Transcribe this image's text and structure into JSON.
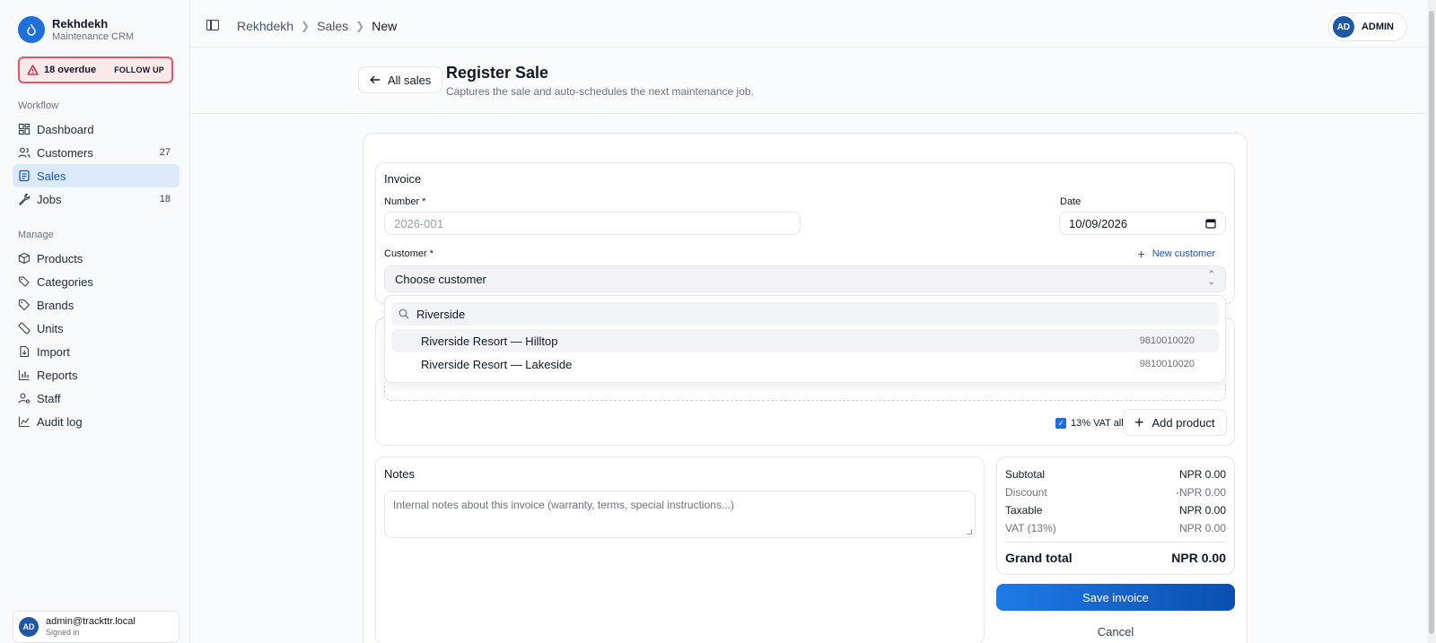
{
  "app": {
    "name": "Rekhdekh",
    "subtitle": "Maintenance CRM"
  },
  "alert": {
    "count_text": "18 overdue",
    "action": "FOLLOW UP"
  },
  "sidebar": {
    "workflow_label": "Workflow",
    "manage_label": "Manage",
    "workflow": [
      {
        "label": "Dashboard",
        "icon": "grid-icon"
      },
      {
        "label": "Customers",
        "icon": "users-icon",
        "count": "27"
      },
      {
        "label": "Sales",
        "icon": "receipt-icon",
        "active": true
      },
      {
        "label": "Jobs",
        "icon": "wrench-icon",
        "count": "18"
      }
    ],
    "manage": [
      {
        "label": "Products",
        "icon": "box-icon"
      },
      {
        "label": "Categories",
        "icon": "tags-icon"
      },
      {
        "label": "Brands",
        "icon": "tag-icon"
      },
      {
        "label": "Units",
        "icon": "ruler-icon"
      },
      {
        "label": "Import",
        "icon": "file-import-icon"
      },
      {
        "label": "Reports",
        "icon": "bar-chart-icon"
      },
      {
        "label": "Staff",
        "icon": "user-gear-icon"
      },
      {
        "label": "Audit log",
        "icon": "activity-icon"
      }
    ]
  },
  "user": {
    "initials": "AD",
    "email": "admin@trackttr.local",
    "status": "Signed in"
  },
  "topbar": {
    "breadcrumb": [
      "Rekhdekh",
      "Sales",
      "New"
    ],
    "admin_initials": "AD",
    "admin_label": "ADMIN"
  },
  "header": {
    "back_label": "All sales",
    "title": "Register Sale",
    "subtitle": "Captures the sale and auto-schedules the next maintenance job."
  },
  "invoice": {
    "title": "Invoice",
    "number_label": "Number *",
    "number_placeholder": "2026-001",
    "date_label": "Date",
    "date_value": "10/09/2026",
    "customer_label": "Customer *",
    "new_customer": "New customer",
    "customer_select": "Choose customer",
    "search_value": "Riverside",
    "options": [
      {
        "name": "Riverside Resort — Hilltop",
        "phone": "9810010020"
      },
      {
        "name": "Riverside Resort — Lakeside",
        "phone": "9810010020"
      }
    ]
  },
  "products": {
    "vat_all_label": "13% VAT all",
    "vat_all_checked": true,
    "add_label": "Add product"
  },
  "notes": {
    "title": "Notes",
    "placeholder": "Internal notes about this invoice (warranty, terms, special instructions...)"
  },
  "totals": {
    "subtotal_label": "Subtotal",
    "subtotal": "NPR 0.00",
    "discount_label": "Discount",
    "discount": "-NPR 0.00",
    "taxable_label": "Taxable",
    "taxable": "NPR 0.00",
    "vat_label": "VAT (13%)",
    "vat": "NPR 0.00",
    "grand_label": "Grand total",
    "grand": "NPR 0.00"
  },
  "actions": {
    "save": "Save invoice",
    "cancel": "Cancel"
  },
  "colors": {
    "accent": "#1e6fd9",
    "alert_border": "#e4566a",
    "alert_bg": "#fde8ea",
    "active_nav": "#dbe9fb"
  }
}
